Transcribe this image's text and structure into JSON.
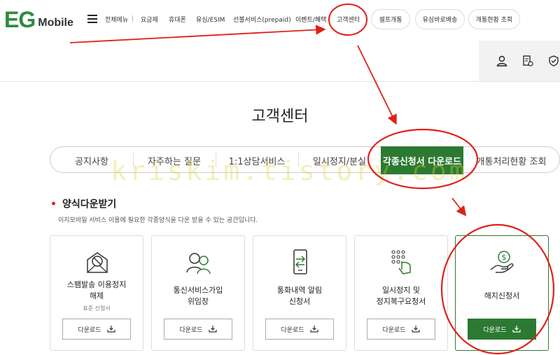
{
  "header": {
    "logo_text": "EG",
    "logo_suffix": "Mobile",
    "nav": [
      {
        "label": "전체메뉴"
      },
      {
        "label": "요금제"
      },
      {
        "label": "휴대폰"
      },
      {
        "label": "유심/ESIM"
      },
      {
        "label": "선불서비스(prepaid)"
      },
      {
        "label": "이벤트/혜택"
      },
      {
        "label": "고객센터"
      }
    ],
    "pills": [
      {
        "label": "셀프개통"
      },
      {
        "label": "유심바로배송"
      },
      {
        "label": "개통현황 조회"
      }
    ],
    "util_icons": [
      "user-icon",
      "document-gear-icon",
      "shield-check-icon"
    ]
  },
  "page": {
    "title": "고객센터",
    "watermark": "kriskim.tistory.com"
  },
  "tabs": [
    {
      "label": "공지사항",
      "active": false
    },
    {
      "label": "자주하는 질문",
      "active": false
    },
    {
      "label": "1:1상담서비스",
      "active": false
    },
    {
      "label": "일시정지/분실",
      "active": false
    },
    {
      "label": "각종신청서 다운로드",
      "active": true
    },
    {
      "label": "개통처리현황 조회",
      "active": false
    }
  ],
  "section": {
    "title": "양식다운받기",
    "description": "이지모바일 서비스 이용에 필요한 각종양식을 다운 받을 수 있는 공간입니다."
  },
  "cards": [
    {
      "title_line1": "스팸발송 이용정지",
      "title_line2": "해제",
      "subtitle": "표준 신청서",
      "button": "다운로드",
      "icon": "spam-mail-icon"
    },
    {
      "title_line1": "통신서비스가입",
      "title_line2": "위임장",
      "subtitle": "",
      "button": "다운로드",
      "icon": "people-icon"
    },
    {
      "title_line1": "통화내역 알림",
      "title_line2": "신청서",
      "subtitle": "",
      "button": "다운로드",
      "icon": "phone-transfer-icon"
    },
    {
      "title_line1": "일시정지 및",
      "title_line2": "정지복구요청서",
      "subtitle": "",
      "button": "다운로드",
      "icon": "keypad-hand-icon"
    },
    {
      "title_line1": "해지신청서",
      "title_line2": "",
      "subtitle": "",
      "button": "다운로드",
      "icon": "hand-coin-icon"
    }
  ],
  "colors": {
    "brand_green": "#2c7a31",
    "accent_red": "#e2242b",
    "annotation_red": "#e0201a"
  }
}
